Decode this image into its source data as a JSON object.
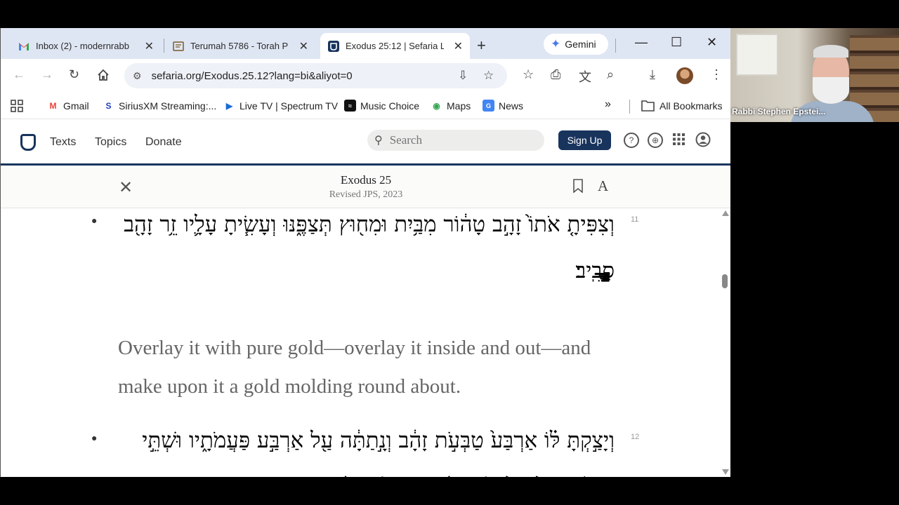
{
  "tabs": [
    {
      "label": "Inbox (2) - modernrabb",
      "icon": "gmail-icon"
    },
    {
      "label": "Terumah 5786 - Torah P",
      "icon": "document-icon"
    },
    {
      "label": "Exodus 25:12 | Sefaria L",
      "icon": "sefaria-icon",
      "active": true
    }
  ],
  "gemini_label": "Gemini",
  "address": {
    "url": "sefaria.org/Exodus.25.12?lang=bi&aliyot=0"
  },
  "bookmarks": [
    {
      "label": "Gmail",
      "icon": "gmail-icon"
    },
    {
      "label": "SiriusXM Streaming:...",
      "icon": "siriusxm-icon"
    },
    {
      "label": "Live TV | Spectrum TV",
      "icon": "play-icon"
    },
    {
      "label": "Music Choice",
      "icon": "music-choice-icon"
    },
    {
      "label": "Maps",
      "icon": "maps-icon"
    },
    {
      "label": "News",
      "icon": "news-icon"
    }
  ],
  "all_bookmarks_label": "All Bookmarks",
  "site_nav": {
    "texts": "Texts",
    "topics": "Topics",
    "donate": "Donate"
  },
  "search": {
    "placeholder": "Search"
  },
  "signup_label": "Sign Up",
  "reader": {
    "book_title": "Exodus 25",
    "version_title": "Revised JPS, 2023",
    "font_button": "A"
  },
  "verses": [
    {
      "number": "11",
      "hebrew": "וְצִפִּיתָ֤ אֹתוֹ֙ זָהָ֣ב טָה֔וֹר מִבַּ֥יִת וּמִח֖וּץ תְּצַפֶּ֑נּוּ וְעָשִׂ֧יתָ עָלָ֛יו זֵ֥ר זָהָ֖ב סָבִֽיב׃",
      "english": "Overlay it with pure gold—overlay it inside and out—and make upon it a gold molding round about."
    },
    {
      "number": "12",
      "hebrew": "וְיָצַ֣קְתָּ לּ֗וֹ אַרְבַּע֙ טַבְּעֹ֣ת זָהָ֔ב וְנָ֣תַתָּ֔ה עַ֖ל אַרְבַּ֣ע פַּעֲמֹתָ֑יו וּשְׁתֵּ֣י טַבָּעֹ֗ת עַל־צַלְעוֹ֙ הָֽאֶחָ֔ת וּשְׁתֵּי֙ טַבָּעֹ֔ת"
    }
  ],
  "video": {
    "participant_name": "Rabbi Stephen Epstei..."
  },
  "colors": {
    "sefaria_blue": "#18345d",
    "tabstrip": "#dfe6f3"
  }
}
